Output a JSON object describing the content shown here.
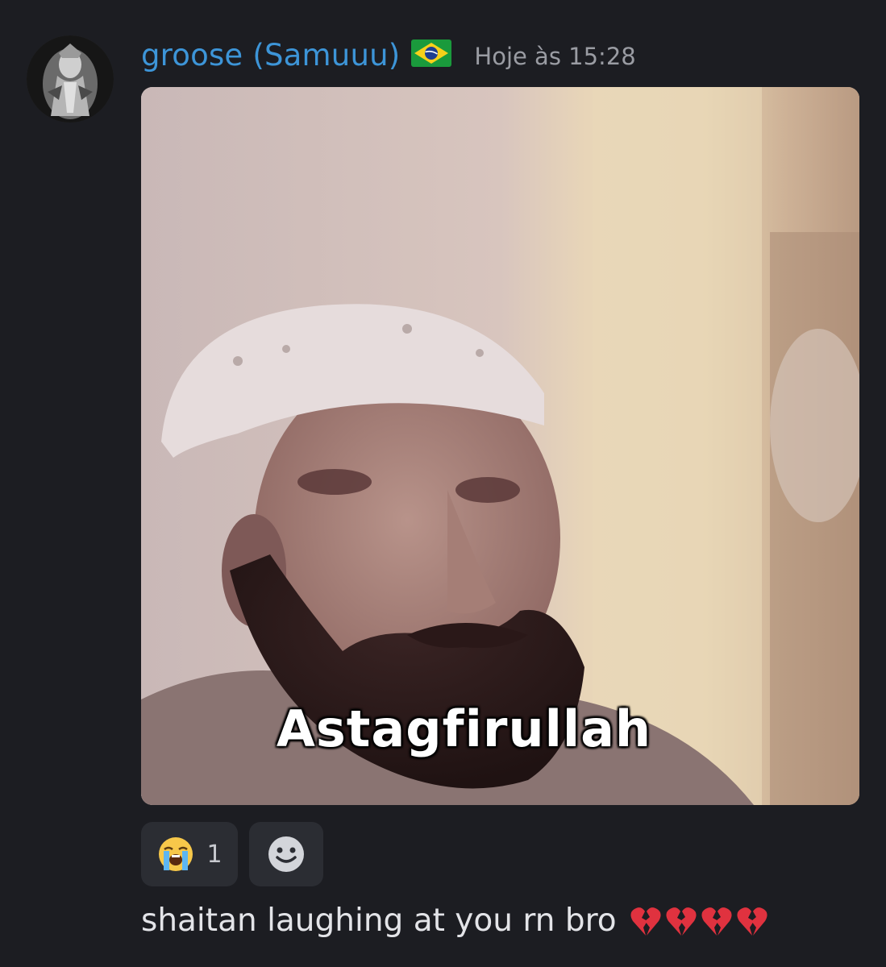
{
  "message": {
    "author": "groose (Samuuu)",
    "author_flag": "flag-brazil",
    "timestamp": "Hoje às 15:28",
    "avatar": "avatar-image",
    "gif": {
      "caption": "Astagfirullah"
    },
    "reactions": [
      {
        "emoji": "loudly-crying-face",
        "count": "1"
      }
    ],
    "add_reaction_icon": "add-reaction-smile-icon",
    "text": "shaitan laughing at you rn bro",
    "text_emojis": [
      "broken-heart",
      "broken-heart",
      "broken-heart",
      "broken-heart"
    ]
  },
  "colors": {
    "background": "#1c1d22",
    "username": "#3d95d8",
    "timestamp": "#9a9ca3",
    "reaction_bg": "#2b2d33",
    "text": "#e3e4e8"
  }
}
